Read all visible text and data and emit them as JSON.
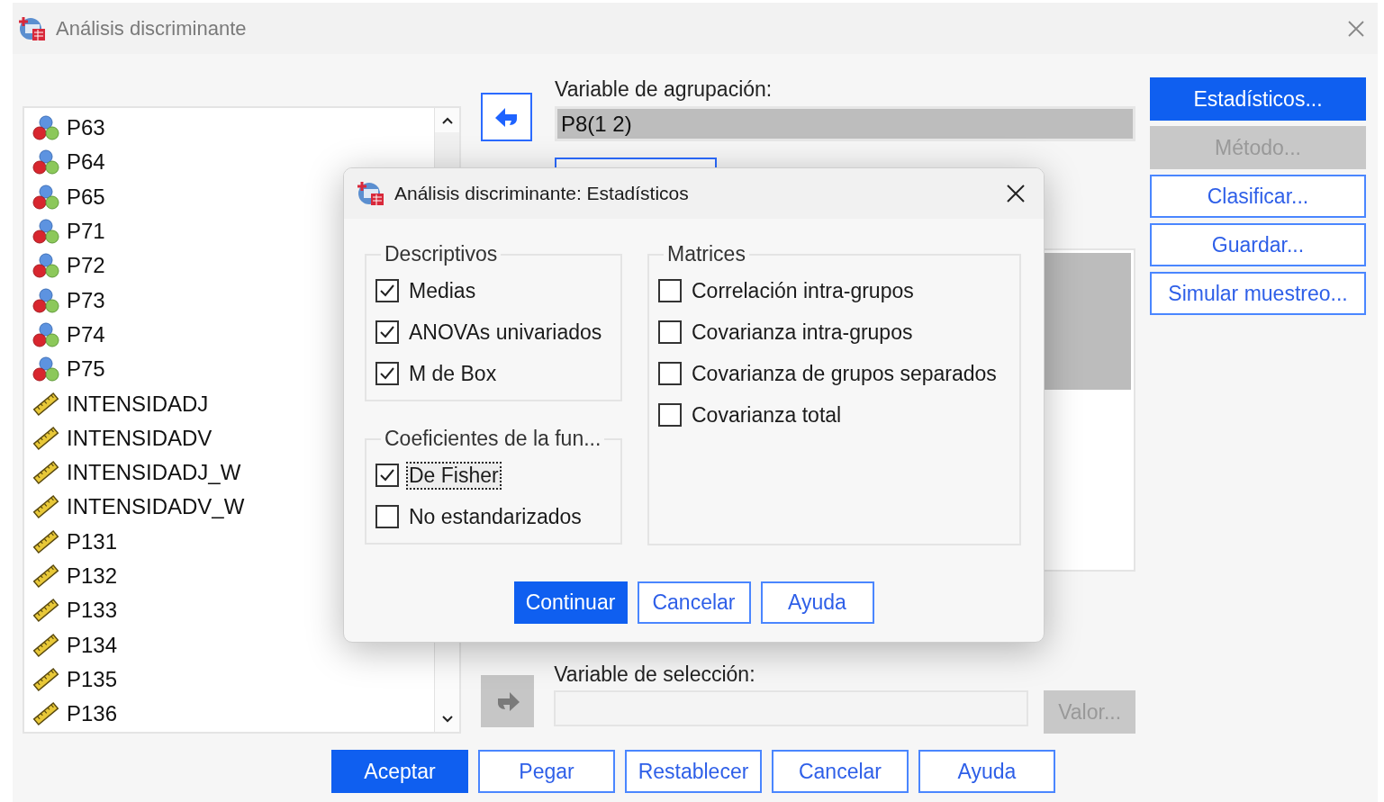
{
  "window": {
    "title": "Análisis discriminante"
  },
  "variables": [
    {
      "name": "P63",
      "kind": "nominal"
    },
    {
      "name": "P64",
      "kind": "nominal"
    },
    {
      "name": "P65",
      "kind": "nominal"
    },
    {
      "name": "P71",
      "kind": "nominal"
    },
    {
      "name": "P72",
      "kind": "nominal"
    },
    {
      "name": "P73",
      "kind": "nominal"
    },
    {
      "name": "P74",
      "kind": "nominal"
    },
    {
      "name": "P75",
      "kind": "nominal"
    },
    {
      "name": "INTENSIDADJ",
      "kind": "scale"
    },
    {
      "name": "INTENSIDADV",
      "kind": "scale"
    },
    {
      "name": "INTENSIDADJ_W",
      "kind": "scale"
    },
    {
      "name": "INTENSIDADV_W",
      "kind": "scale"
    },
    {
      "name": "P131",
      "kind": "scale"
    },
    {
      "name": "P132",
      "kind": "scale"
    },
    {
      "name": "P133",
      "kind": "scale"
    },
    {
      "name": "P134",
      "kind": "scale"
    },
    {
      "name": "P135",
      "kind": "scale"
    },
    {
      "name": "P136",
      "kind": "scale"
    }
  ],
  "grouping": {
    "label": "Variable de agrupación:",
    "value": "P8(1 2)",
    "arrow_disabled": false
  },
  "selection": {
    "label": "Variable de selección:",
    "arrow_disabled": true,
    "button": {
      "label": "Valor...",
      "disabled": true
    }
  },
  "side_buttons": [
    {
      "label": "Estadísticos...",
      "default": true,
      "disabled": false
    },
    {
      "label": "Método...",
      "default": false,
      "disabled": true
    },
    {
      "label": "Clasificar...",
      "default": false,
      "disabled": false
    },
    {
      "label": "Guardar...",
      "default": false,
      "disabled": false
    },
    {
      "label": "Simular muestreo...",
      "default": false,
      "disabled": false
    }
  ],
  "buttons": [
    {
      "label": "Aceptar",
      "default": true
    },
    {
      "label": "Pegar",
      "default": false
    },
    {
      "label": "Restablecer",
      "default": false
    },
    {
      "label": "Cancelar",
      "default": false
    },
    {
      "label": "Ayuda",
      "default": false
    }
  ],
  "dialog": {
    "title": "Análisis discriminante: Estadísticos",
    "groups": [
      {
        "title": "Descriptivos",
        "options": [
          {
            "label": "Medias",
            "checked": true,
            "focused": false
          },
          {
            "label": "ANOVAs univariados",
            "checked": true,
            "focused": false
          },
          {
            "label": "M de Box",
            "checked": true,
            "focused": false
          }
        ]
      },
      {
        "title": "Coeficientes de la fun...",
        "options": [
          {
            "label": "De Fisher",
            "checked": true,
            "focused": true
          },
          {
            "label": "No estandarizados",
            "checked": false,
            "focused": false
          }
        ]
      },
      {
        "title": "Matrices",
        "options": [
          {
            "label": "Correlación intra-grupos",
            "checked": false,
            "focused": false
          },
          {
            "label": "Covarianza intra-grupos",
            "checked": false,
            "focused": false
          },
          {
            "label": "Covarianza de grupos separados",
            "checked": false,
            "focused": false
          },
          {
            "label": "Covarianza total",
            "checked": false,
            "focused": false
          }
        ]
      }
    ],
    "buttons": [
      {
        "label": "Continuar",
        "default": true
      },
      {
        "label": "Cancelar",
        "default": false
      },
      {
        "label": "Ayuda",
        "default": false
      }
    ]
  }
}
